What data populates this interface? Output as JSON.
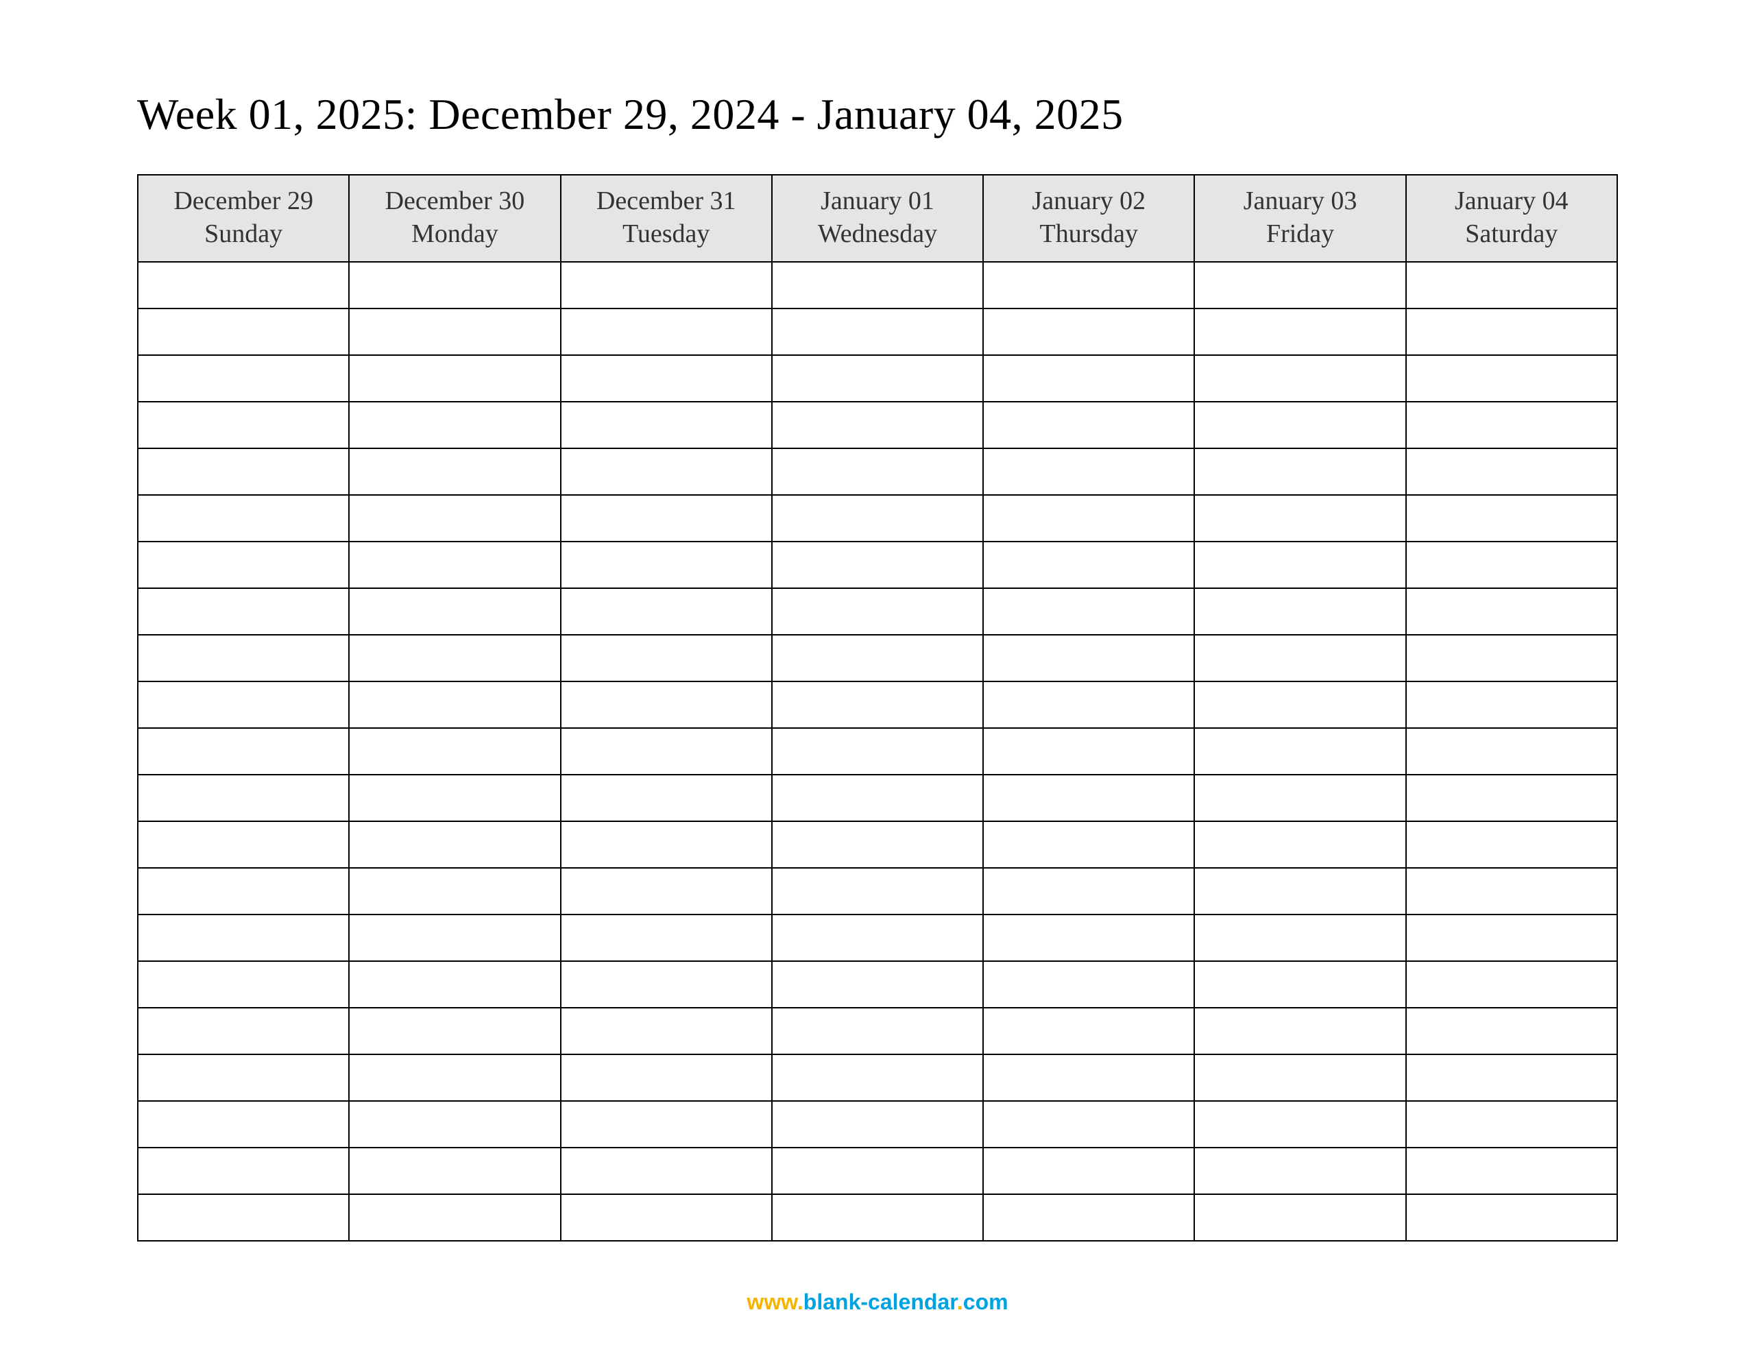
{
  "title": "Week 01, 2025: December 29, 2024 - January 04, 2025",
  "columns": [
    {
      "date": "December 29",
      "weekday": "Sunday"
    },
    {
      "date": "December 30",
      "weekday": "Monday"
    },
    {
      "date": "December 31",
      "weekday": "Tuesday"
    },
    {
      "date": "January 01",
      "weekday": "Wednesday"
    },
    {
      "date": "January 02",
      "weekday": "Thursday"
    },
    {
      "date": "January 03",
      "weekday": "Friday"
    },
    {
      "date": "January 04",
      "weekday": "Saturday"
    }
  ],
  "row_count": 21,
  "footer": {
    "w3": "www.",
    "host": "blank-calendar",
    "dot": ".",
    "tld": "com"
  }
}
